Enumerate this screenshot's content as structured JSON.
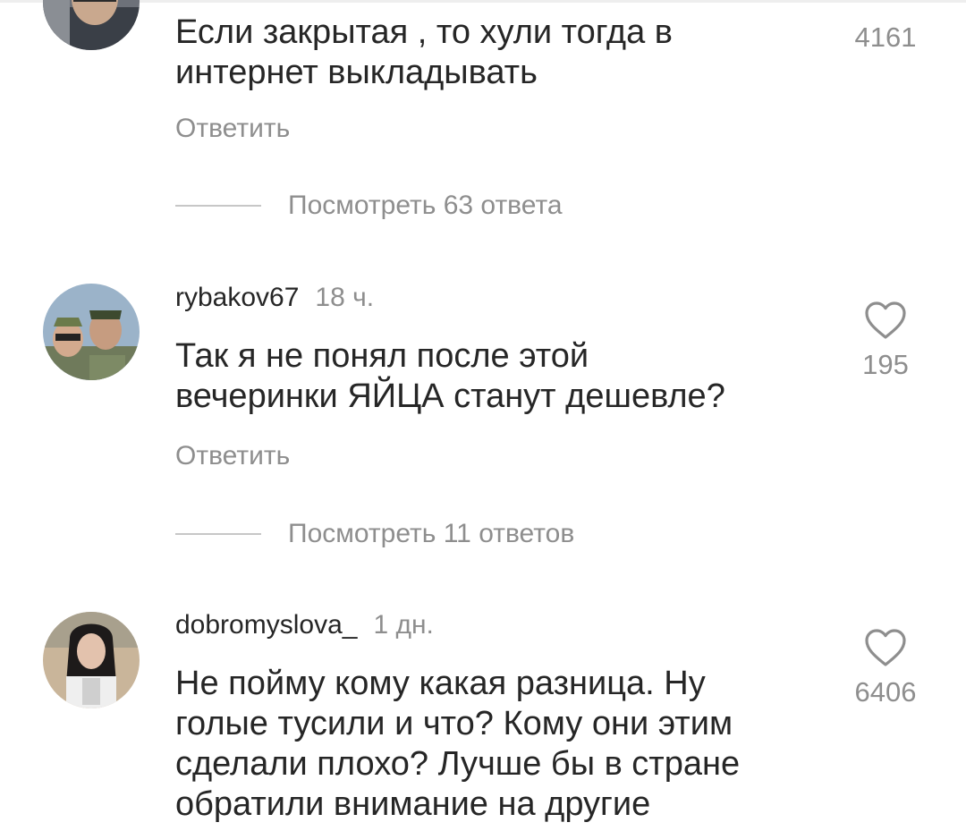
{
  "comments": [
    {
      "username": "",
      "time": "",
      "text_lines": [
        "Если закрытая , то хули тогда в",
        "интернет выкладывать"
      ],
      "reply_label": "Ответить",
      "likes": "4161",
      "view_replies": "Посмотреть 63 ответа"
    },
    {
      "username": "rybakov67",
      "time": "18 ч.",
      "text_lines": [
        "Так я не понял после этой",
        "вечеринки ЯЙЦА станут дешевле?"
      ],
      "reply_label": "Ответить",
      "likes": "195",
      "view_replies": "Посмотреть 11 ответов"
    },
    {
      "username": "dobromyslova_",
      "time": "1 дн.",
      "text_lines": [
        "Не пойму кому какая разница.  Ну",
        "голые тусили и что? Кому они этим",
        "сделали плохо? Лучше бы в стране",
        "обратили внимание на другие"
      ],
      "likes": "6406"
    }
  ],
  "icons": {
    "like": "heart-outline-icon"
  },
  "colors": {
    "text": "#262626",
    "secondary": "#8e8e8e",
    "divider": "#c7c7c7"
  }
}
